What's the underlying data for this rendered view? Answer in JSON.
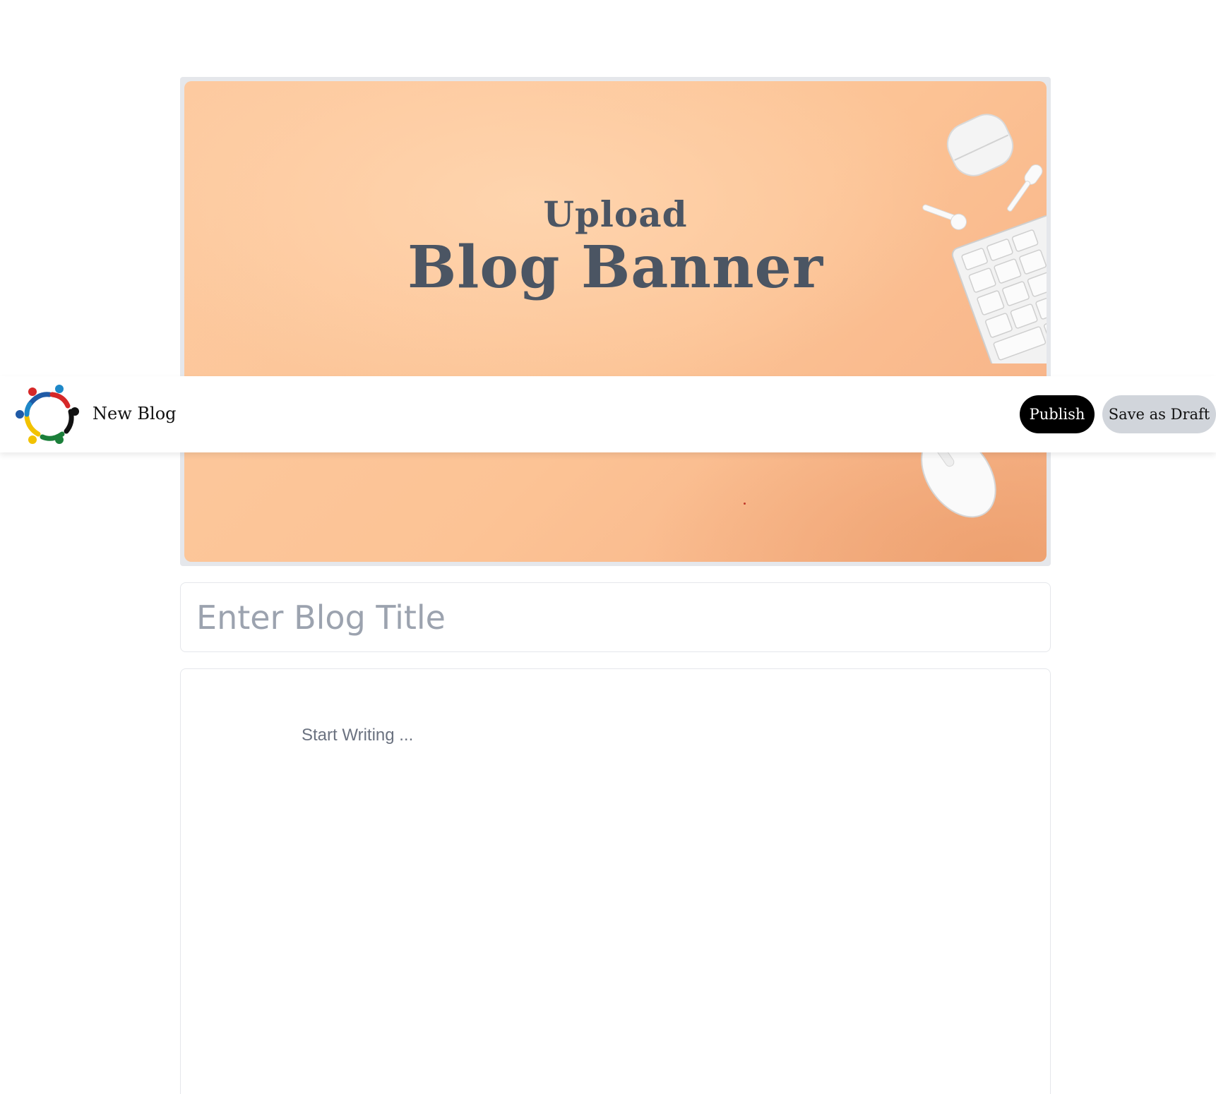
{
  "banner": {
    "upload_label": "Upload",
    "title": "Blog Banner"
  },
  "header": {
    "page_label": "New Blog",
    "publish_label": "Publish",
    "draft_label": "Save as Draft"
  },
  "title_field": {
    "placeholder": "Enter Blog Title",
    "value": ""
  },
  "editor": {
    "placeholder": "Start Writing ..."
  },
  "colors": {
    "banner_peach": "#fcc395",
    "banner_text": "#4b5563",
    "publish_bg": "#000000",
    "draft_bg": "#d1d5db",
    "placeholder": "#9ca3af"
  }
}
